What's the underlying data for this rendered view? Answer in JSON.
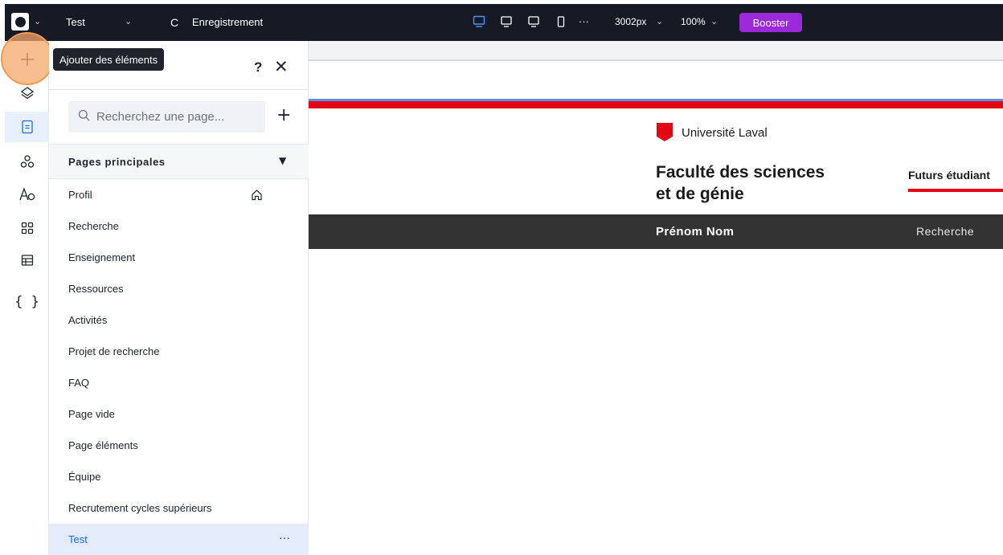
{
  "topbar": {
    "site_name": "Test",
    "undo_glyph": "C",
    "save_label": "Enregistrement",
    "more_glyph": "···",
    "width_value": "3002px",
    "zoom_value": "100%",
    "booster_label": "Booster",
    "chevron": "⌄",
    "icons": [
      "logo-icon",
      "desktop-icon",
      "laptop-icon",
      "tablet-icon",
      "mobile-icon"
    ]
  },
  "rail": {
    "tooltip": "Ajouter des éléments",
    "code_glyph": "{ }",
    "icons": [
      "plus-icon",
      "layers-icon",
      "pages-icon",
      "design-icon",
      "typography-icon",
      "apps-icon",
      "table-icon",
      "code-icon"
    ]
  },
  "panel": {
    "help": "?",
    "close": "✕",
    "search_placeholder": "Recherchez une page...",
    "add": "+",
    "section_title": "Pages principales",
    "section_arrow": "▼",
    "pages": [
      "Profil",
      "Recherche",
      "Enseignement",
      "Ressources",
      "Activités",
      "Projet de recherche",
      "FAQ",
      "Page vide",
      "Page éléments",
      "Équipe",
      "Recrutement cycles supérieurs",
      "Test"
    ],
    "selected_page": "Test",
    "more": "···"
  },
  "canvas": {
    "university": "Université Laval",
    "faculty_line1": "Faculté des sciences",
    "faculty_line2": "et de génie",
    "nav_item": "Futurs étudiant",
    "person_name": "Prénom Nom",
    "nav_recherche": "Recherche"
  },
  "colors": {
    "topbar_bg": "#161a25",
    "booster": "#9b28d9",
    "accent_blue": "#116dff",
    "ul_red": "#e30613",
    "dark_band": "#333333",
    "highlight": "#f4a86a"
  }
}
